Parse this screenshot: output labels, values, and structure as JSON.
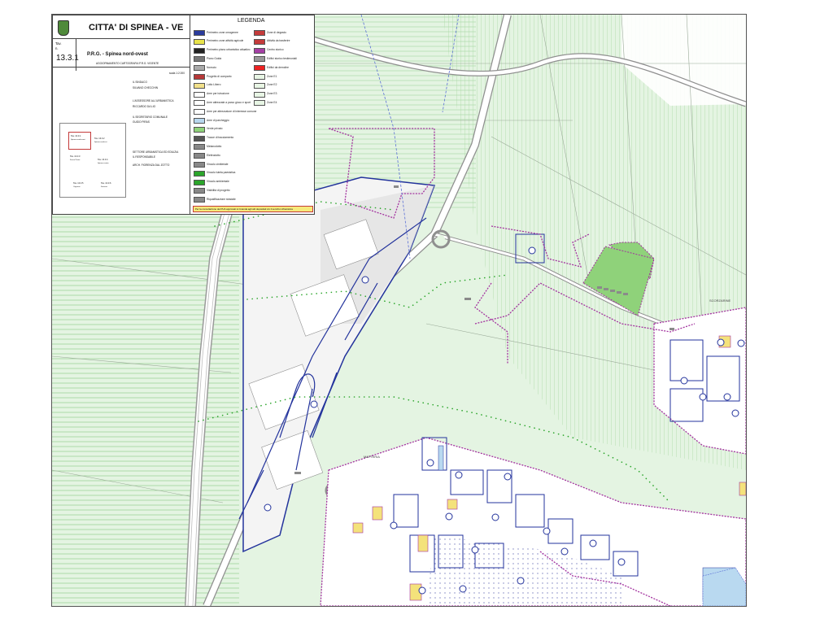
{
  "header": {
    "city_title": "CITTA' DI SPINEA - VE",
    "tav_label": "Tav.",
    "tav_n": "n.",
    "tav_number": "13.3.1",
    "plan_title": "P.R.G. - Spinea nord-ovest",
    "plan_subtitle": "AGGIORNAMENTO CARTOGRAFIA P.R.G. VIGENTE",
    "scale": "scala 1:2.000"
  },
  "signatures": [
    {
      "role": "IL SINDACO",
      "name": "SILVANO CHECCHIN"
    },
    {
      "role": "L'ASSESSORE ALL'URBANISTICA",
      "name": "RICCARDO DA LIO"
    },
    {
      "role": "IL SEGRETARIO COMUNALE",
      "name": "GUIDO PIRAS"
    },
    {
      "role": "SETTORE URBANISTICA ED EDILIZIA",
      "name": "IL RESPONSABILE"
    },
    {
      "role": "ARCH. FIORENZA DAL ZOTTO",
      "name": ""
    }
  ],
  "key_map": {
    "tiles": [
      "Tav. 13.3.1",
      "Tav. 13.3.2",
      "Tav. 13.3.3",
      "Tav. 13.3.4",
      "Tav. 13.3.5",
      "Tav. 13.3.6"
    ],
    "tile_names": [
      "Spinea nord-ovest",
      "Spinea nord-est",
      "Fossa Ponte",
      "Spinea centro",
      "Orgnano",
      "Fornase"
    ]
  },
  "legend": {
    "title": "LEGENDA",
    "left_items": [
      {
        "label": "Perimetro zone omogenee",
        "color": "#2a3b9c"
      },
      {
        "label": "Perimetro zone attività agricole",
        "color": "#e8e34a"
      },
      {
        "label": "Perimetro piano urbanistico attuativo",
        "color": "#222222"
      },
      {
        "label": "Piano Guida",
        "color": "#777777"
      },
      {
        "label": "Nonscio",
        "color": "#aaaaaa"
      },
      {
        "label": "Progetto di comparto",
        "color": "#b73838"
      },
      {
        "label": "Lotto Libero",
        "color": "#f1e08a"
      },
      {
        "label": "Aree per istruzione",
        "color": "#ffffff"
      },
      {
        "label": "Aree attrezzate a parco gioco e sport",
        "color": "#ffffff"
      },
      {
        "label": "Aree per attrezzature di interesse comune",
        "color": "#ffffff"
      },
      {
        "label": "Aree di parcheggio",
        "color": "#b8d7ee"
      },
      {
        "label": "Verde privato",
        "color": "#8fd27a"
      },
      {
        "label": "Tracce di tracciamento",
        "color": "#555555"
      },
      {
        "label": "Metanodotto",
        "color": "#888888"
      },
      {
        "label": "Elettrodotto",
        "color": "#888888"
      },
      {
        "label": "Vincolo cimiteriale",
        "color": "#888888"
      },
      {
        "label": "Vincolo tutela paesistica",
        "color": "#2ba52b"
      },
      {
        "label": "Vincolo ambientale",
        "color": "#2ba52b"
      },
      {
        "label": "Visibilità di progetto",
        "color": "#888888"
      },
      {
        "label": "Riqualificazione stradale",
        "color": "#888888"
      }
    ],
    "right_items": [
      {
        "label": "Zone di degrado",
        "color": "#c43b3b"
      },
      {
        "label": "Attività da trasferire",
        "color": "#c43b3b"
      },
      {
        "label": "Centro storico",
        "color": "#a53fa5"
      },
      {
        "label": "Edifici storico testimoniali",
        "color": "#999999"
      },
      {
        "label": "Edifici da demolire",
        "color": "#ee2222"
      },
      {
        "label": "Zone E1",
        "color": "#e8f6e5"
      },
      {
        "label": "Zone E2",
        "color": "#e8f6e5"
      },
      {
        "label": "Zone E3",
        "color": "#e8f6e5"
      },
      {
        "label": "Zone E4",
        "color": "#e8f6e5"
      }
    ],
    "footer_note": "Per la consultazione dei PUA approvati si rimanda agli atti depositati c/o il servizio Urbanistica"
  },
  "map_labels": {
    "place_1": "SCORZARINE",
    "place_2": "MATTERIA"
  },
  "colors": {
    "agri_bg": "#e4f4e2",
    "hatch": "#9fd49a",
    "road_edge": "#9a9a9a",
    "zone_blue": "#23339c",
    "historic_purple": "#a3339f",
    "garden_green": "#8fd27a",
    "lot_yellow": "#f4e27b",
    "park_blue": "#b9d9f0",
    "building_grey": "#8a8a8a"
  }
}
